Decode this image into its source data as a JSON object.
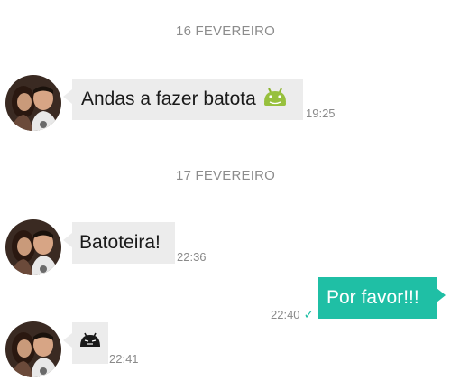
{
  "colors": {
    "incoming_bubble": "#ececec",
    "outgoing_bubble": "#1fbfa5",
    "timestamp": "#8a8a8a",
    "read_check": "#1fbfa5"
  },
  "chat": {
    "date_separators": [
      "16 FEVEREIRO",
      "17 FEVEREIRO"
    ],
    "messages": [
      {
        "direction": "incoming",
        "text": "Andas a fazer batota",
        "emoji": "android-icon",
        "time": "19:25"
      },
      {
        "direction": "incoming",
        "text": "Batoteira!",
        "time": "22:36"
      },
      {
        "direction": "outgoing",
        "text": "Por favor!!!",
        "time": "22:40",
        "status": "✓"
      },
      {
        "direction": "incoming",
        "text": "",
        "emoji": "grumpy-face-icon",
        "time": "22:41"
      }
    ]
  }
}
